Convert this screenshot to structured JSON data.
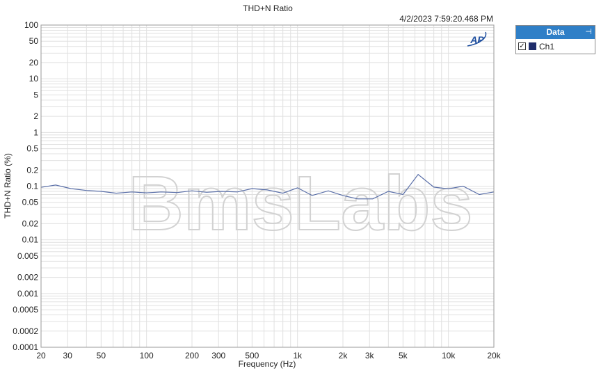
{
  "legend_panel": {
    "header": "Data",
    "items": [
      {
        "label": "Ch1",
        "checked": true,
        "check_glyph": "✓",
        "color": "#1f2d6b"
      }
    ]
  },
  "brand": {
    "badge": "AP",
    "watermark": "BmsLabs"
  },
  "colors": {
    "series": "#5a6fa8",
    "panel_header": "#2f7fc7",
    "grid": "#e0e0e0"
  },
  "chart_data": {
    "type": "line",
    "title": "THD+N Ratio",
    "timestamp": "4/2/2023 7:59:20.468 PM",
    "xlabel": "Frequency (Hz)",
    "ylabel": "THD+N Ratio (%)",
    "xscale": "log",
    "yscale": "log",
    "xlim": [
      20,
      20000
    ],
    "ylim": [
      0.0001,
      100
    ],
    "grid": true,
    "legend_position": "right",
    "x_ticks": [
      {
        "value": 20,
        "label": "20"
      },
      {
        "value": 30,
        "label": "30"
      },
      {
        "value": 50,
        "label": "50"
      },
      {
        "value": 100,
        "label": "100"
      },
      {
        "value": 200,
        "label": "200"
      },
      {
        "value": 300,
        "label": "300"
      },
      {
        "value": 500,
        "label": "500"
      },
      {
        "value": 1000,
        "label": "1k"
      },
      {
        "value": 2000,
        "label": "2k"
      },
      {
        "value": 3000,
        "label": "3k"
      },
      {
        "value": 5000,
        "label": "5k"
      },
      {
        "value": 10000,
        "label": "10k"
      },
      {
        "value": 20000,
        "label": "20k"
      }
    ],
    "y_ticks": [
      {
        "value": 100,
        "label": "100"
      },
      {
        "value": 50,
        "label": "50"
      },
      {
        "value": 20,
        "label": "20"
      },
      {
        "value": 10,
        "label": "10"
      },
      {
        "value": 5,
        "label": "5"
      },
      {
        "value": 2,
        "label": "2"
      },
      {
        "value": 1,
        "label": "1"
      },
      {
        "value": 0.5,
        "label": "0.5"
      },
      {
        "value": 0.2,
        "label": "0.2"
      },
      {
        "value": 0.1,
        "label": "0.1"
      },
      {
        "value": 0.05,
        "label": "0.05"
      },
      {
        "value": 0.02,
        "label": "0.02"
      },
      {
        "value": 0.01,
        "label": "0.01"
      },
      {
        "value": 0.005,
        "label": "0.005"
      },
      {
        "value": 0.002,
        "label": "0.002"
      },
      {
        "value": 0.001,
        "label": "0.001"
      },
      {
        "value": 0.0005,
        "label": "0.0005"
      },
      {
        "value": 0.0002,
        "label": "0.0002"
      },
      {
        "value": 0.0001,
        "label": "0.0001"
      }
    ],
    "series": [
      {
        "name": "Ch1",
        "x": [
          20,
          25,
          31.5,
          40,
          50,
          63,
          80,
          100,
          125,
          160,
          200,
          250,
          315,
          400,
          500,
          630,
          800,
          1000,
          1250,
          1600,
          2000,
          2500,
          3150,
          4000,
          5000,
          6300,
          8000,
          10000,
          12500,
          16000,
          20000
        ],
        "y": [
          0.095,
          0.105,
          0.09,
          0.083,
          0.08,
          0.074,
          0.078,
          0.075,
          0.078,
          0.076,
          0.082,
          0.077,
          0.08,
          0.078,
          0.09,
          0.085,
          0.074,
          0.093,
          0.067,
          0.082,
          0.067,
          0.058,
          0.058,
          0.08,
          0.07,
          0.165,
          0.096,
          0.089,
          0.1,
          0.07,
          0.078
        ]
      }
    ]
  }
}
